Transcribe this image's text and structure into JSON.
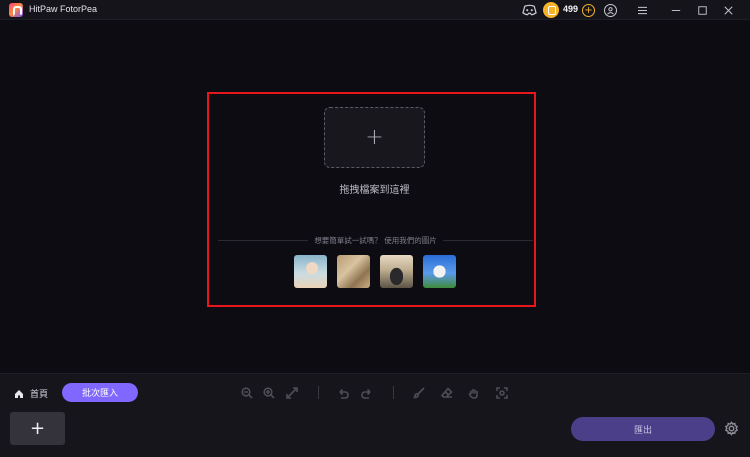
{
  "app": {
    "title": "HitPaw FotorPea"
  },
  "titlebar": {
    "credits": "499",
    "icons": [
      "discord-icon",
      "coin-icon",
      "add-credit-icon",
      "account-icon",
      "menu-icon",
      "minimize-icon",
      "maximize-icon",
      "close-icon"
    ]
  },
  "dropzone": {
    "label": "拖拽檔案到這裡",
    "try_text": "想要簡單試一試嗎？",
    "try_link": "使用我們的圖片",
    "samples": [
      "sample-child-portrait",
      "sample-paper-texture",
      "sample-car",
      "sample-dog"
    ]
  },
  "footer": {
    "home_label": "首頁",
    "batch_label": "批次匯入",
    "add_symbol": "+",
    "export_label": "匯出"
  },
  "colors": {
    "background": "#0d0c12",
    "accent": "#7f67ff",
    "highlight_frame": "#e8161d",
    "coin": "#f5b32a"
  }
}
